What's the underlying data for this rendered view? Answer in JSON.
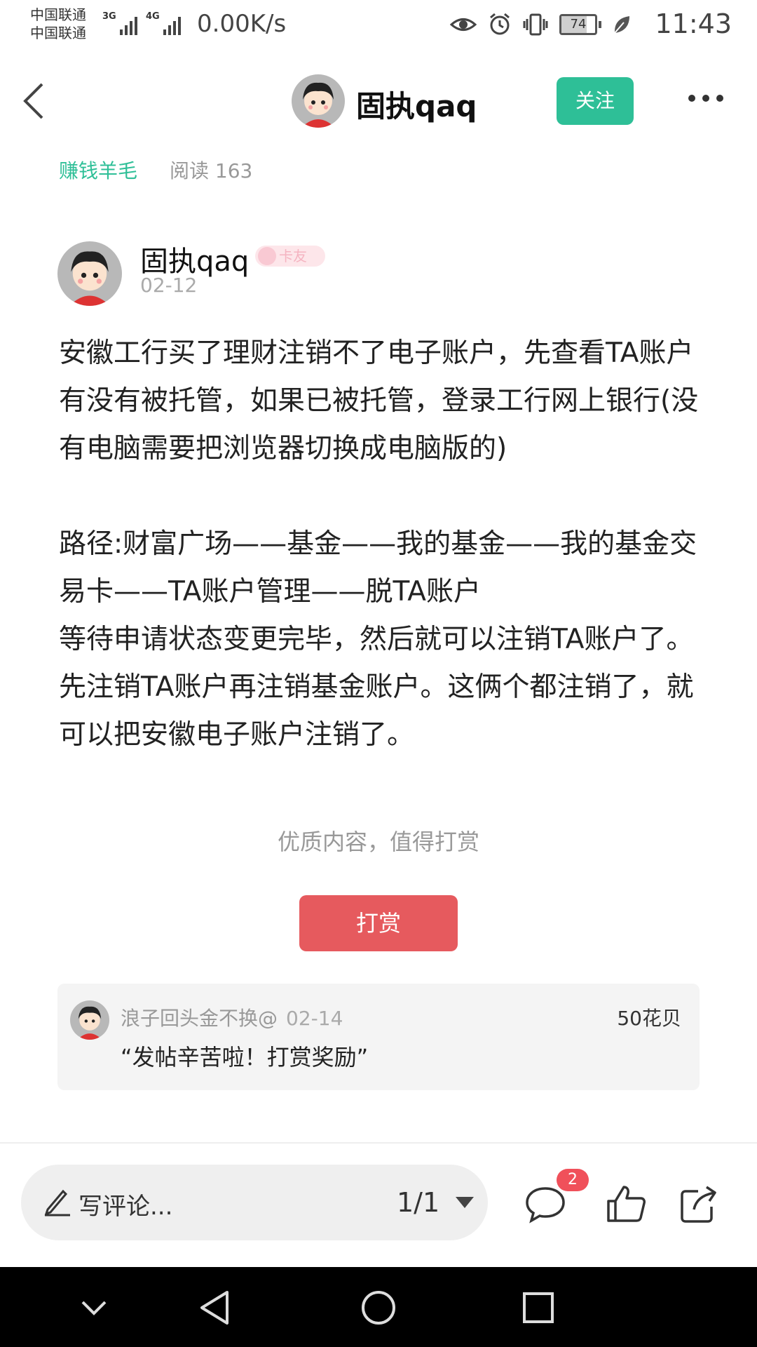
{
  "status_bar": {
    "carrier1": "中国联通",
    "carrier2": "中国联通",
    "net1": "3G",
    "net2": "4G",
    "net_speed": "0.00K/s",
    "battery": "74",
    "battery_fraction": 0.74,
    "time": "11:43"
  },
  "header": {
    "author": "固执qaq",
    "follow_label": "关注"
  },
  "meta": {
    "category": "赚钱羊毛",
    "reads": "阅读 163"
  },
  "author": {
    "name": "固执qaq",
    "badge": "卡友",
    "date": "02-12"
  },
  "post": {
    "paragraph1": "安徽工行买了理财注销不了电子账户，先查看TA账户有没有被托管，如果已被托管，登录工行网上银行(没有电脑需要把浏览器切换成电脑版的)",
    "paragraph2": "路径:财富广场——基金——我的基金——我的基金交易卡——TA账户管理——脱TA账户",
    "paragraph3": "等待申请状态变更完毕，然后就可以注销TA账户了。先注销TA账户再注销基金账户。这俩个都注销了，就可以把安徽电子账户注销了。"
  },
  "reward": {
    "hint": "优质内容，值得打赏",
    "button": "打赏",
    "record": {
      "user": "浪子回头金不换@",
      "date": "02-14",
      "amount": "50花贝",
      "message": "“发帖辛苦啦！打赏奖励”"
    }
  },
  "toolbar": {
    "comment_placeholder": "写评论...",
    "page": "1/1",
    "comment_count": "2"
  }
}
